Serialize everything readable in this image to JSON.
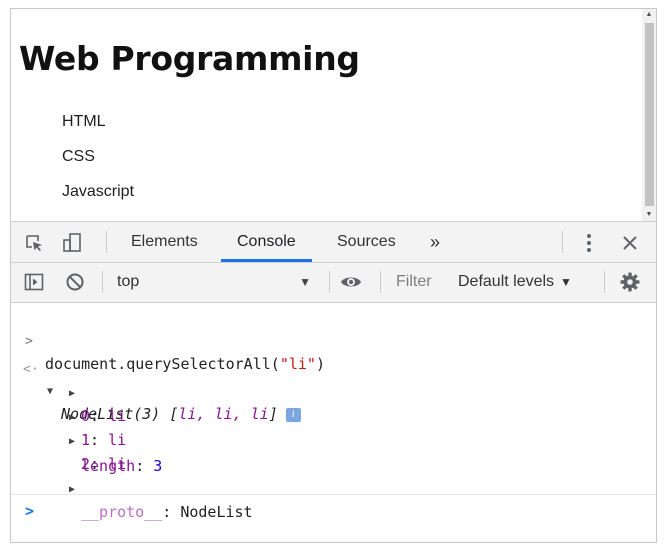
{
  "page": {
    "title": "Web Programming",
    "list_items": [
      "HTML",
      "CSS",
      "Javascript"
    ]
  },
  "devtools": {
    "tabs": [
      "Elements",
      "Console",
      "Sources"
    ],
    "active_tab": "Console",
    "more_tabs_glyph": "»",
    "icons": [
      "inspect-element-icon",
      "device-toggle-icon",
      "kebab-menu-icon",
      "close-icon"
    ]
  },
  "console_toolbar": {
    "context": "top",
    "filter_placeholder": "Filter",
    "levels": "Default levels",
    "icons": [
      "sidebar-toggle-icon",
      "clear-console-icon",
      "eye-icon",
      "gear-icon"
    ]
  },
  "console": {
    "command_prefix": "document.querySelectorAll(",
    "command_string": "\"li\"",
    "command_suffix": ")",
    "result_head": "NodeList(3) [",
    "result_items": "li, li, li",
    "result_tail": "]",
    "info_badge": "i",
    "entries": [
      {
        "key": "0",
        "value": "li"
      },
      {
        "key": "1",
        "value": "li"
      },
      {
        "key": "2",
        "value": "li"
      }
    ],
    "length_key": "length",
    "length_value": "3",
    "proto_key": "__proto__",
    "proto_value": "NodeList"
  },
  "colors": {
    "accent": "#1a73e8",
    "key": "#881391",
    "string": "#c41a16",
    "number": "#1c00cf"
  }
}
